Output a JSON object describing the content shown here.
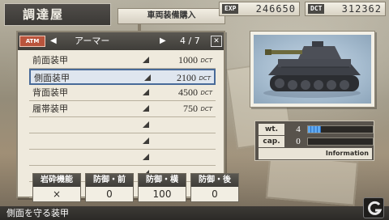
{
  "header": {
    "title": "調達屋",
    "subtitle": "車両装備購入"
  },
  "stats": {
    "exp_label": "EXP",
    "exp_value": "246650",
    "dct_label": "DCT",
    "dct_value": "312362"
  },
  "list": {
    "badge": "ATM",
    "category": "アーマー",
    "page": "4 / 7",
    "unit": "DCT",
    "items": [
      {
        "name": "前面装甲",
        "price": "1000"
      },
      {
        "name": "側面装甲",
        "price": "2100"
      },
      {
        "name": "背面装甲",
        "price": "4500"
      },
      {
        "name": "履帯装甲",
        "price": "750"
      },
      {
        "name": "",
        "price": ""
      },
      {
        "name": "",
        "price": ""
      },
      {
        "name": "",
        "price": ""
      },
      {
        "name": "",
        "price": ""
      },
      {
        "name": "",
        "price": ""
      }
    ],
    "selected_index": 1
  },
  "attributes": [
    {
      "label": "岩砕機能",
      "value": "×"
    },
    {
      "label": "防御・前",
      "value": "0"
    },
    {
      "label": "防御・横",
      "value": "100"
    },
    {
      "label": "防御・後",
      "value": "0"
    }
  ],
  "vehicle_stats": {
    "wt_label": "wt.",
    "wt_value": "4",
    "wt_fill": 0.2,
    "cap_label": "cap.",
    "cap_value": "0",
    "cap_fill": 0,
    "info_label": "Information"
  },
  "footer": {
    "description": "側面を守る装甲"
  },
  "colors": {
    "accent": "#486a98",
    "bar": "#5fa9f0",
    "header_dark": "#3f3d39"
  }
}
